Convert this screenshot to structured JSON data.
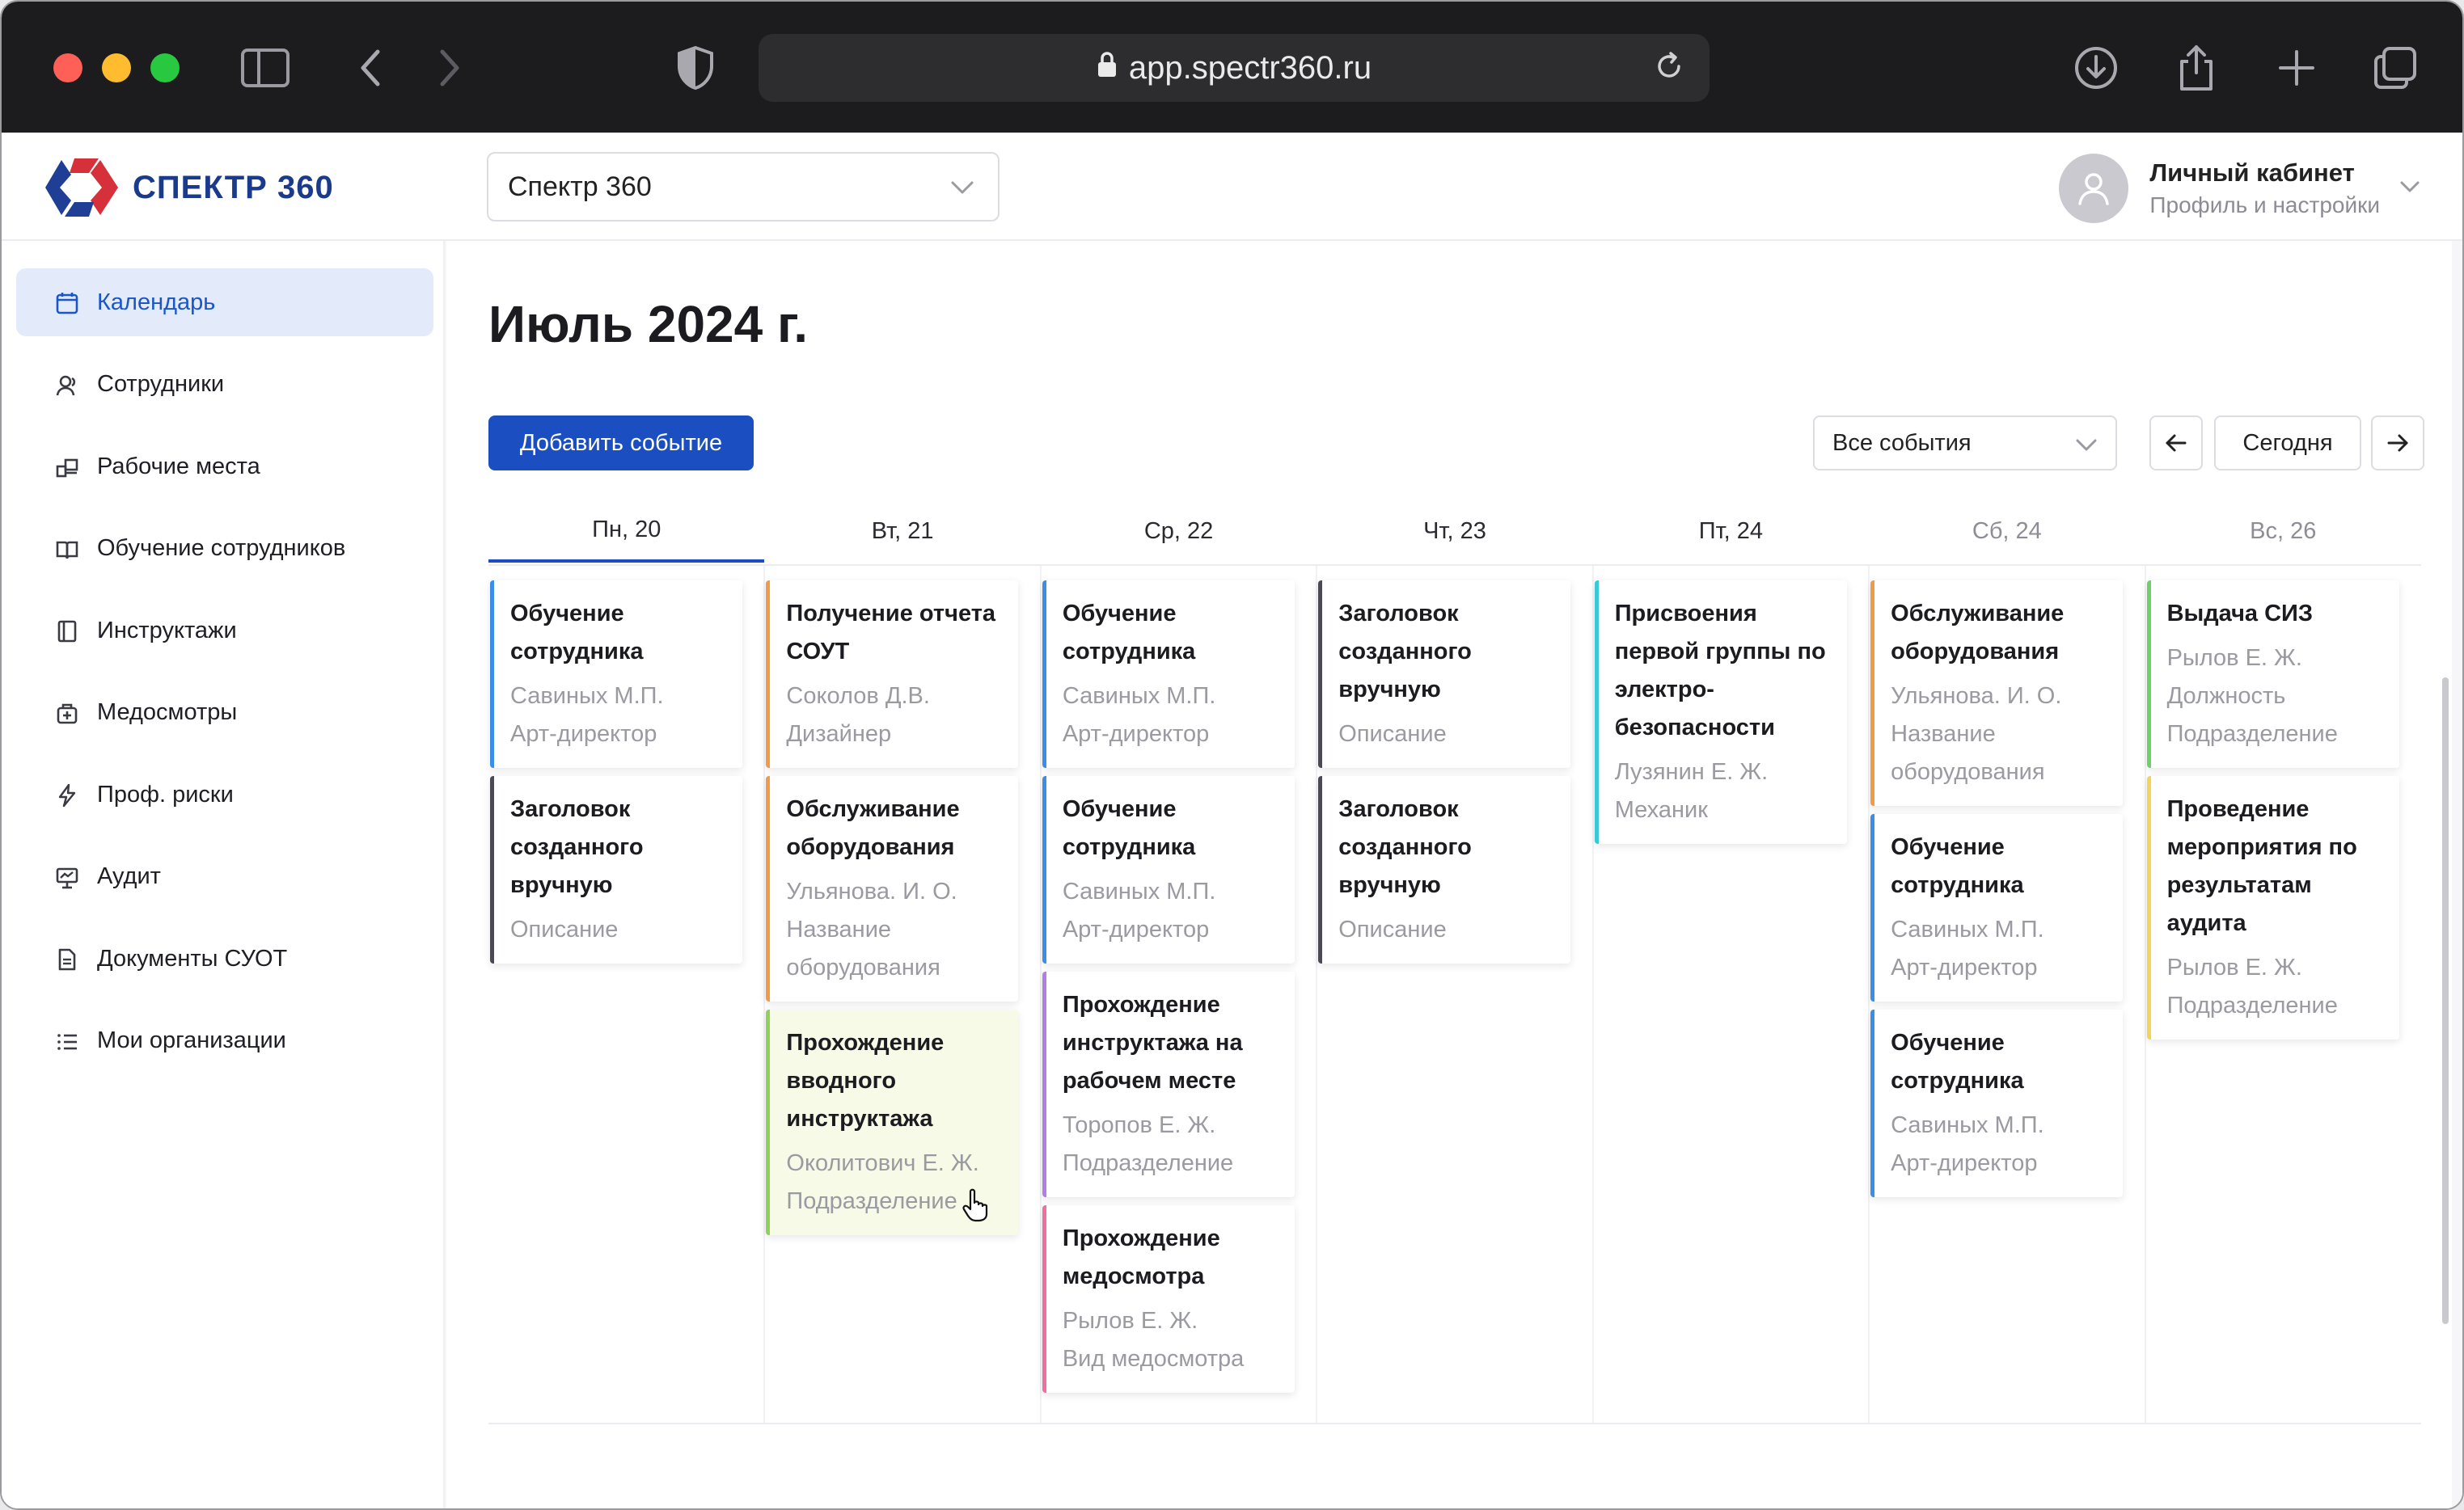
{
  "browser": {
    "url": "app.spectr360.ru"
  },
  "header": {
    "logo_text": "СПЕКТР 360",
    "org_select_value": "Спектр 360",
    "user_name": "Личный кабинет",
    "user_subtitle": "Профиль и настройки"
  },
  "sidebar": {
    "items": [
      {
        "label": "Календарь",
        "icon": "calendar-icon",
        "active": true
      },
      {
        "label": "Сотрудники",
        "icon": "people-icon"
      },
      {
        "label": "Рабочие места",
        "icon": "workplace-icon"
      },
      {
        "label": "Обучение сотрудников",
        "icon": "book-icon"
      },
      {
        "label": "Инструктажи",
        "icon": "document-icon"
      },
      {
        "label": "Медосмотры",
        "icon": "medkit-icon"
      },
      {
        "label": "Проф. риски",
        "icon": "lightning-icon"
      },
      {
        "label": "Аудит",
        "icon": "chart-board-icon"
      },
      {
        "label": "Документы СУОТ",
        "icon": "file-icon"
      },
      {
        "label": "Мои организации",
        "icon": "list-icon"
      }
    ]
  },
  "main": {
    "title": "Июль 2024 г.",
    "add_button": "Добавить событие",
    "filter_value": "Все события",
    "today_button": "Сегодня"
  },
  "calendar": {
    "days": [
      {
        "label": "Пн, 20",
        "today": true,
        "weekend": false
      },
      {
        "label": "Вт, 21",
        "weekend": false
      },
      {
        "label": "Ср, 22",
        "weekend": false
      },
      {
        "label": "Чт, 23",
        "weekend": false
      },
      {
        "label": "Пт, 24",
        "weekend": false
      },
      {
        "label": "Сб, 24",
        "weekend": true
      },
      {
        "label": "Вс, 26",
        "weekend": true
      }
    ],
    "events": [
      [
        {
          "title": [
            "Обучение",
            "сотрудника"
          ],
          "lines": [
            "Савиных М.П.",
            "Арт-директор"
          ],
          "color": "#3b8ee8"
        },
        {
          "title": [
            "Заголовок",
            "созданного",
            "вручную"
          ],
          "lines": [
            "Описание"
          ],
          "color": "#4a4a52"
        }
      ],
      [
        {
          "title": [
            "Получение отчета",
            "СОУТ"
          ],
          "lines": [
            "Соколов Д.В.",
            "Дизайнер"
          ],
          "color": "#f29a4a"
        },
        {
          "title": [
            "Обслуживание",
            "оборудования"
          ],
          "lines": [
            "Ульянова. И. О.",
            "Название",
            "оборудования"
          ],
          "color": "#f29a4a"
        },
        {
          "title": [
            "Прохождение",
            "вводного",
            "инструктажа"
          ],
          "lines": [
            "Околитович Е. Ж.",
            "Подразделение"
          ],
          "color": "#8fd15a",
          "highlight": true
        }
      ],
      [
        {
          "title": [
            "Обучение",
            "сотрудника"
          ],
          "lines": [
            "Савиных М.П.",
            "Арт-директор"
          ],
          "color": "#3b8ee8"
        },
        {
          "title": [
            "Обучение",
            "сотрудника"
          ],
          "lines": [
            "Савиных М.П.",
            "Арт-директор"
          ],
          "color": "#3b8ee8"
        },
        {
          "title": [
            "Прохождение",
            "инструктажа на",
            "рабочем месте"
          ],
          "lines": [
            "Торопов Е. Ж.",
            "Подразделение"
          ],
          "color": "#b07fe6"
        },
        {
          "title": [
            "Прохождение",
            "медосмотра"
          ],
          "lines": [
            "Рылов Е. Ж.",
            "Вид медосмотра"
          ],
          "color": "#ef6fa0"
        }
      ],
      [
        {
          "title": [
            "Заголовок",
            "созданного",
            "вручную"
          ],
          "lines": [
            "Описание"
          ],
          "color": "#4a4a52"
        },
        {
          "title": [
            "Заголовок",
            "созданного",
            "вручную"
          ],
          "lines": [
            "Описание"
          ],
          "color": "#4a4a52"
        }
      ],
      [
        {
          "title": [
            "Присвоения",
            "первой группы по",
            "электро-",
            "безопасности"
          ],
          "lines": [
            "Лузянин Е. Ж.",
            "Механик"
          ],
          "color": "#37c9d6"
        }
      ],
      [
        {
          "title": [
            "Обслуживание",
            "оборудования"
          ],
          "lines": [
            "Ульянова. И. О.",
            "Название",
            "оборудования"
          ],
          "color": "#f29a4a"
        },
        {
          "title": [
            "Обучение",
            "сотрудника"
          ],
          "lines": [
            "Савиных М.П.",
            "Арт-директор"
          ],
          "color": "#3b8ee8"
        },
        {
          "title": [
            "Обучение",
            "сотрудника"
          ],
          "lines": [
            "Савиных М.П.",
            "Арт-директор"
          ],
          "color": "#3b8ee8"
        }
      ],
      [
        {
          "title": [
            "Выдача СИЗ"
          ],
          "lines": [
            "Рылов Е. Ж.",
            "Должность",
            "Подразделение"
          ],
          "color": "#6fd06a"
        },
        {
          "title": [
            "Проведение",
            "мероприятия по",
            "результатам",
            "аудита"
          ],
          "lines": [
            "Рылов Е. Ж.",
            "Подразделение"
          ],
          "color": "#f3d35a"
        }
      ]
    ]
  }
}
